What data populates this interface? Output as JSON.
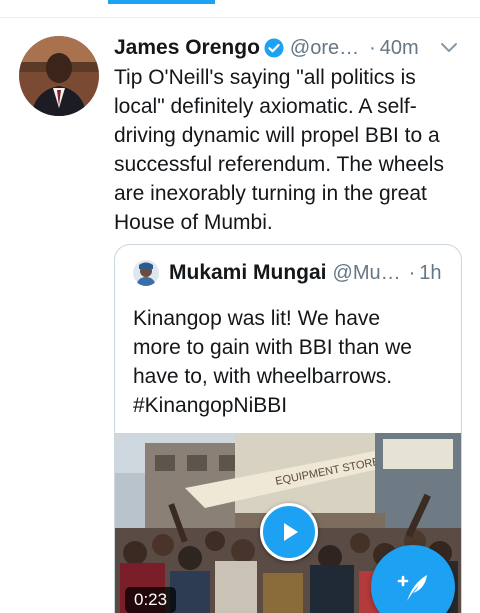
{
  "tweet": {
    "display_name": "James Orengo",
    "handle": "@ore…",
    "separator": "·",
    "time": "40m",
    "text": "Tip O'Neill's saying \"all politics is local\" definitely axiomatic. A self-driving dynamic will propel BBI to a successful referendum. The wheels are inexorably turning in the great House of Mumbi."
  },
  "quote": {
    "display_name": "Mukami Mungai",
    "handle": "@Mu…",
    "separator": "·",
    "time": "1h",
    "text_lines": [
      "Kinangop was lit!  We have",
      "more to gain with BBI than we",
      "have to, with wheelbarrows.",
      "#KinangopNiBBI"
    ],
    "video": {
      "duration": "0:23",
      "sign_text": "EQUIPMENT STORES"
    }
  },
  "colors": {
    "accent": "#1da1f2",
    "secondary_text": "#657786",
    "border": "#ccd6dd"
  },
  "icons": [
    "verified-badge-icon",
    "chevron-down-icon",
    "play-icon",
    "compose-tweet-icon"
  ]
}
